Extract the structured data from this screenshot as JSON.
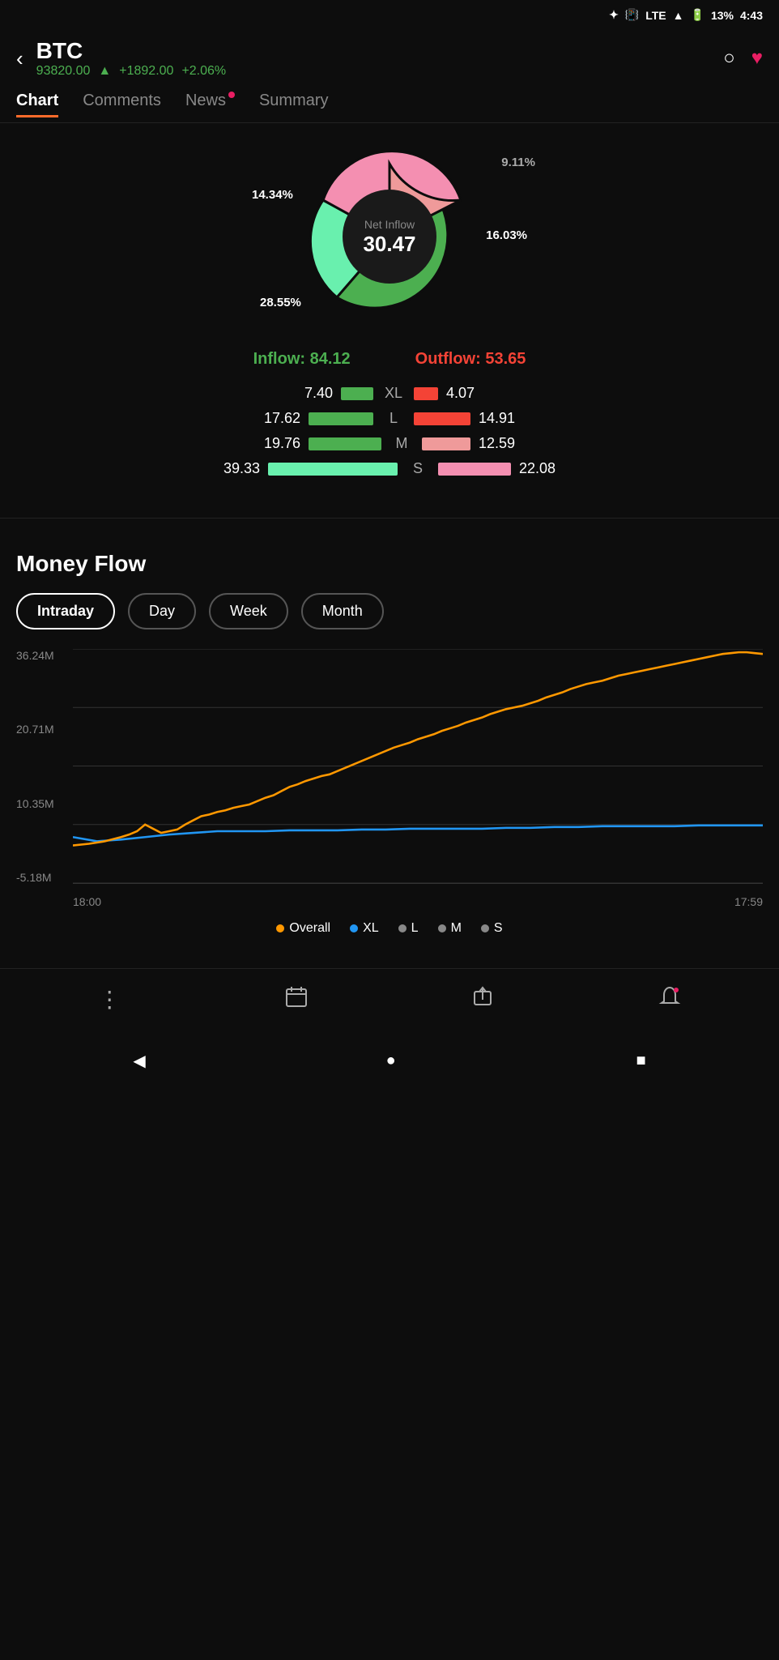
{
  "status_bar": {
    "battery": "13%",
    "time": "4:43",
    "signal": "LTE"
  },
  "header": {
    "back_label": "‹",
    "ticker": "BTC",
    "price": "93820.00",
    "change_abs": "+1892.00",
    "change_pct": "+2.06%",
    "search_label": "🔍",
    "fav_label": "♥"
  },
  "nav_tabs": {
    "items": [
      {
        "label": "Chart",
        "active": true,
        "has_dot": false
      },
      {
        "label": "Comments",
        "active": false,
        "has_dot": false
      },
      {
        "label": "News",
        "active": false,
        "has_dot": true
      },
      {
        "label": "Summary",
        "active": false,
        "has_dot": false
      }
    ]
  },
  "donut_chart": {
    "net_inflow_label": "Net Inflow",
    "net_inflow_value": "30.47",
    "pct_top_right": "9.11%",
    "pct_left": "14.34%",
    "pct_bottom_left": "28.55%",
    "pct_right": "16.03%"
  },
  "flow_summary": {
    "inflow_label": "Inflow:",
    "inflow_value": "84.12",
    "outflow_label": "Outflow:",
    "outflow_value": "53.65"
  },
  "flow_bars": [
    {
      "label": "XL",
      "inflow": 7.4,
      "outflow": 4.07,
      "in_bar": 40,
      "out_bar": 30
    },
    {
      "label": "L",
      "inflow": 17.62,
      "outflow": 14.91,
      "in_bar": 80,
      "out_bar": 70
    },
    {
      "label": "M",
      "inflow": 19.76,
      "outflow": 12.59,
      "in_bar": 90,
      "out_bar": 60
    },
    {
      "label": "S",
      "inflow": 39.33,
      "outflow": 22.08,
      "in_bar": 160,
      "out_bar": 90
    }
  ],
  "money_flow": {
    "title": "Money Flow",
    "time_tabs": [
      {
        "label": "Intraday",
        "active": true
      },
      {
        "label": "Day",
        "active": false
      },
      {
        "label": "Week",
        "active": false
      },
      {
        "label": "Month",
        "active": false
      }
    ],
    "y_labels": [
      "36.24M",
      "20.71M",
      "10.35M",
      "-5.18M"
    ],
    "x_labels": [
      "18:00",
      "17:59"
    ],
    "legend": [
      {
        "label": "Overall",
        "color": "#ff9800"
      },
      {
        "label": "XL",
        "color": "#2196F3"
      },
      {
        "label": "L",
        "color": "#888"
      },
      {
        "label": "M",
        "color": "#888"
      },
      {
        "label": "S",
        "color": "#888"
      }
    ]
  },
  "toolbar": {
    "items": [
      {
        "icon": "⋮",
        "label": ""
      },
      {
        "icon": "📅",
        "label": ""
      },
      {
        "icon": "↗",
        "label": ""
      },
      {
        "icon": "🔔",
        "label": ""
      }
    ]
  },
  "android_nav": {
    "back": "◀",
    "home": "●",
    "recent": "■"
  }
}
